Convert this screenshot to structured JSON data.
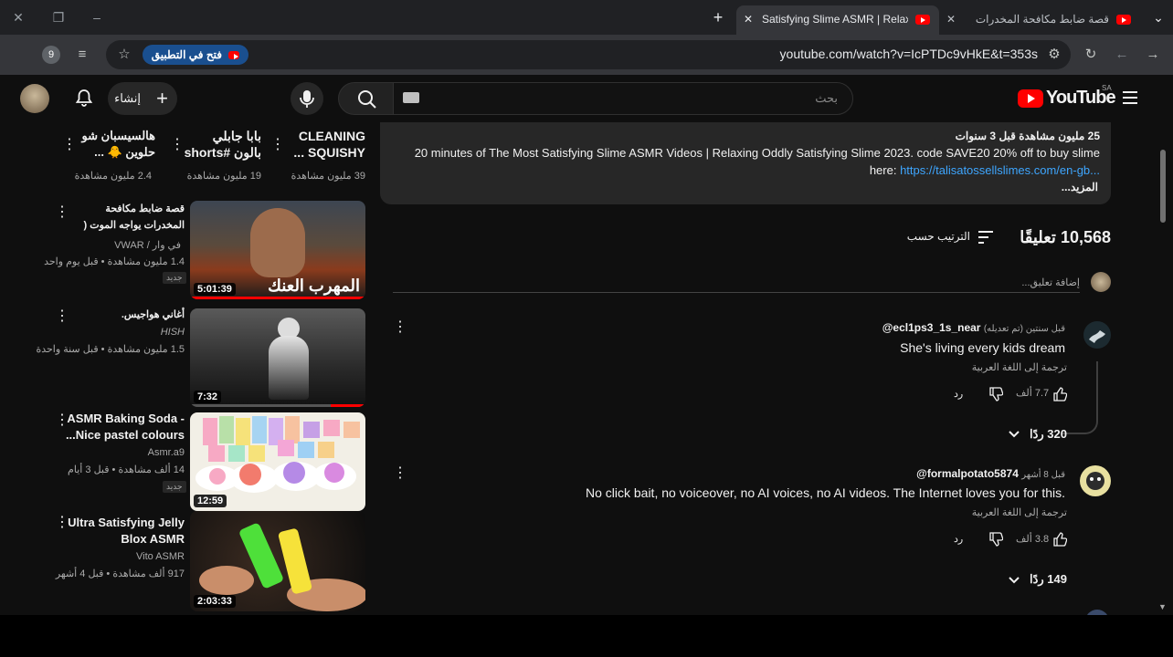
{
  "browser": {
    "tabs": [
      {
        "title": "Satisfying Slime ASMR | Relaxin",
        "active": true
      },
      {
        "title": "قصة ضابط مكافحة المخدرات يواج",
        "active": false
      }
    ],
    "url": "youtube.com/watch?v=IcPTDc9vHkE&t=353s",
    "open_app_label": "فتح في التطبيق",
    "profile_badge": "9"
  },
  "youtube": {
    "logo_text": "YouTube",
    "region": "SA",
    "search_placeholder": "بحث",
    "create_label": "إنشاء"
  },
  "description": {
    "stats": "25 مليون مشاهدة  قبل 3 سنوات",
    "line1": "20 minutes of The Most Satisfying Slime ASMR Videos | Relaxing Oddly Satisfying Slime 2023. code SAVE20 20% off to buy  slime",
    "line2_prefix": "here:",
    "link": "https://talisatossellslimes.com/en-gb...",
    "more": "...المزيد"
  },
  "comments_header": {
    "count": "10,568 تعليقًا",
    "sort": "الترتيب حسب",
    "add_placeholder": "إضافة تعليق..."
  },
  "comments": [
    {
      "author": "@ecl1ps3_1s_near",
      "time": "قبل سنتين (تم تعديله)",
      "text": "She's living every kids dream",
      "translate": "ترجمة إلى اللغة العربية",
      "likes": "7.7 ألف",
      "reply": "رد",
      "replies": "320 ردًا"
    },
    {
      "author": "@formalpotato5874",
      "time": "قبل 8 أشهر",
      "text": "No click bait, no voiceover, no AI voices, no AI videos.  The Internet loves you for this.",
      "translate": "ترجمة إلى اللغة العربية",
      "likes": "3.8 ألف",
      "reply": "رد",
      "replies": "149 ردًا"
    }
  ],
  "shorts": [
    {
      "title": "CLEANING SQUISHY ...",
      "views": "39 مليون مشاهدة"
    },
    {
      "title": "بابا جابلي بالون #shorts - ...",
      "views": "19 مليون مشاهدة"
    },
    {
      "title": "هالسيسبان شو حلوين 🐥 ...",
      "views": "2.4 مليون مشاهدة"
    }
  ],
  "videos": [
    {
      "title": "قصة ضابط مكافحة المخدرات يواجه الموت ( المهرب ...",
      "channel": "في وار / VWAR",
      "meta": "1.4 مليون مشاهدة • قبل يوم واحد",
      "badge": "جديد",
      "duration": "5:01:39",
      "thumb_text": "المهرب العنك"
    },
    {
      "title": "أغاني هواجيس.",
      "channel": "HISH",
      "meta": "1.5 مليون مشاهدة • قبل سنة واحدة",
      "badge": "",
      "duration": "7:32",
      "thumb_text": ""
    },
    {
      "title": "ASMR Baking Soda - Nice pastel colours...",
      "channel": "Asmr.a9",
      "meta": "14 ألف مشاهدة • قبل 3 أيام",
      "badge": "جديد",
      "duration": "12:59",
      "thumb_text": ""
    },
    {
      "title": "Ultra Satisfying Jelly Blox ASMR",
      "channel": "Vito ASMR",
      "meta": "917 ألف مشاهدة • قبل 4 أشهر",
      "badge": "",
      "duration": "2:03:33",
      "thumb_text": ""
    }
  ]
}
